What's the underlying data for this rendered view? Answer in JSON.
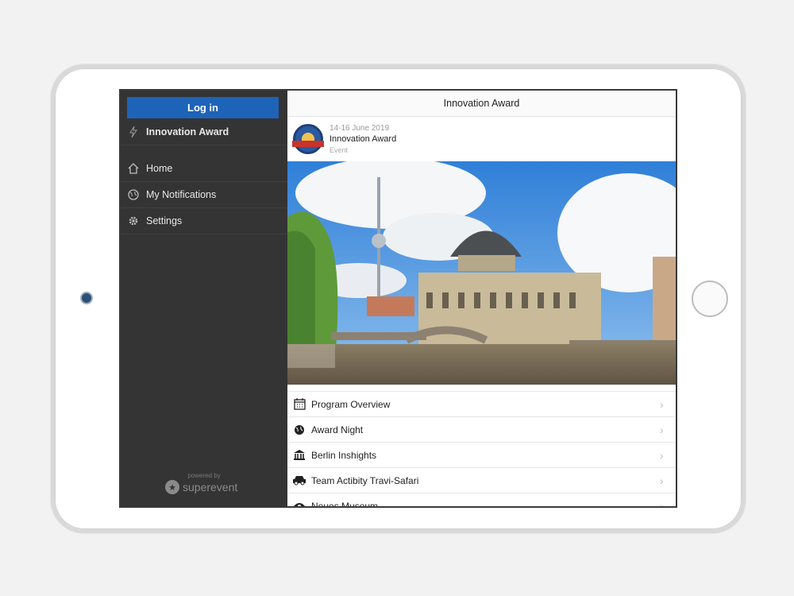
{
  "sidebar": {
    "login_label": "Log in",
    "event_name": "Innovation Award",
    "items": [
      {
        "label": "Home",
        "icon": "home-icon"
      },
      {
        "label": "My Notifications",
        "icon": "globe-icon"
      },
      {
        "label": "Settings",
        "icon": "gear-icon"
      }
    ],
    "powered_by": "powered by",
    "brand": "superevent"
  },
  "main": {
    "header_title": "Innovation Award",
    "event": {
      "date": "14-16 June 2019",
      "title": "Innovation Award",
      "type": "Event"
    },
    "list": [
      {
        "label": "Program Overview",
        "icon": "calendar-icon"
      },
      {
        "label": "Award Night",
        "icon": "globe-icon"
      },
      {
        "label": "Berlin Inshights",
        "icon": "museum-icon"
      },
      {
        "label": "Team Actibity Travi-Safari",
        "icon": "car-icon"
      },
      {
        "label": "Neues Museum",
        "icon": "eye-icon"
      }
    ]
  },
  "colors": {
    "accent": "#1d63b8",
    "sidebar_bg": "#343434"
  }
}
